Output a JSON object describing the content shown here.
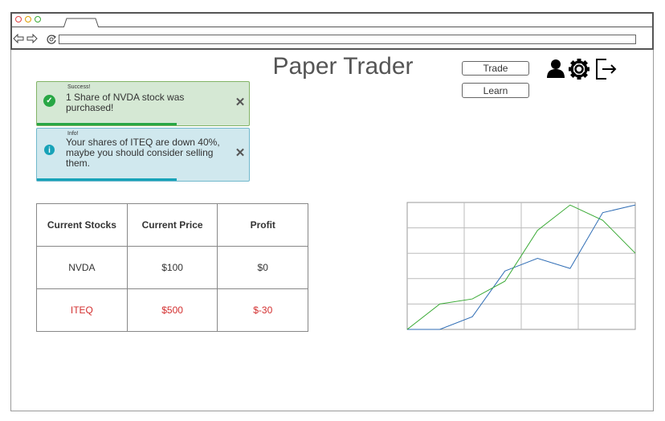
{
  "header": {
    "title": "Paper Trader",
    "nav": {
      "trade": "Trade",
      "learn": "Learn"
    },
    "icons": [
      "user-icon",
      "gear-icon",
      "logout-icon"
    ]
  },
  "alerts": [
    {
      "type": "success",
      "heading": "Success!",
      "message": "1 Share of NVDA stock was purchased!",
      "progress": 0.66,
      "color": "#28a745"
    },
    {
      "type": "info",
      "heading": "Info!",
      "message": "Your shares of ITEQ are down 40%, maybe you should consider selling them.",
      "progress": 0.66,
      "color": "#17a2b8"
    }
  ],
  "table": {
    "headers": [
      "Current Stocks",
      "Current Price",
      "Profit"
    ],
    "rows": [
      {
        "stock": "NVDA",
        "price": "$100",
        "profit": "$0"
      },
      {
        "stock": "ITEQ",
        "price": "$500",
        "profit": "$-30"
      }
    ]
  },
  "colors": {
    "negative": "#d32f2f",
    "series_blue": "#2f6db5",
    "series_green": "#3aaa35"
  },
  "chart_data": {
    "type": "line",
    "x": [
      0,
      1,
      2,
      3,
      4,
      5,
      6,
      7
    ],
    "ylim": [
      0,
      5
    ],
    "xlim": [
      0,
      7
    ],
    "grid": true,
    "series": [
      {
        "values": [
          0,
          0,
          0.5,
          2.3,
          2.8,
          2.4,
          4.6,
          4.9
        ]
      },
      {
        "values": [
          0,
          1.0,
          1.2,
          1.9,
          3.9,
          4.9,
          4.3,
          3.0
        ]
      }
    ]
  }
}
